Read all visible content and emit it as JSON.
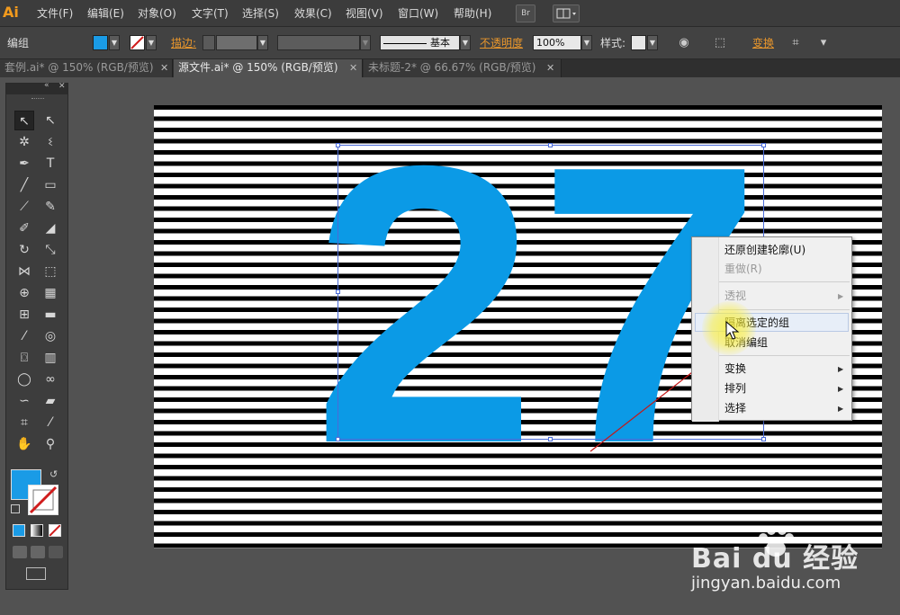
{
  "app": {
    "logo": "Ai",
    "menus": [
      "文件(F)",
      "编辑(E)",
      "对象(O)",
      "文字(T)",
      "选择(S)",
      "效果(C)",
      "视图(V)",
      "窗口(W)",
      "帮助(H)"
    ],
    "bridge_button": "Br"
  },
  "control_bar": {
    "selection_label": "编组",
    "fill_color": "#1a9be6",
    "stroke_label": "描边:",
    "stroke_style": "基本",
    "opacity_label": "不透明度",
    "opacity_value": "100%",
    "style_label": "样式:",
    "transform_label": "变换"
  },
  "tabs": [
    {
      "label": "套例.ai* @ 150% (RGB/预览)",
      "active": false
    },
    {
      "label": "源文件.ai* @ 150% (RGB/预览)",
      "active": true
    },
    {
      "label": "未标题-2* @ 66.67% (RGB/预览)",
      "active": false
    }
  ],
  "canvas": {
    "artwork_text": "27",
    "artwork_color": "#0b9ae6",
    "stripe_color": "#000000"
  },
  "context_menu": {
    "items": [
      {
        "label": "还原创建轮廓(U)",
        "disabled": false,
        "submenu": false
      },
      {
        "label": "重做(R)",
        "disabled": true,
        "submenu": false
      },
      {
        "label": "透视",
        "disabled": true,
        "submenu": true
      },
      {
        "label": "隔离选定的组",
        "disabled": false,
        "submenu": false,
        "highlighted": true
      },
      {
        "label": "取消编组",
        "disabled": false,
        "submenu": false
      },
      {
        "label": "变换",
        "disabled": false,
        "submenu": true
      },
      {
        "label": "排列",
        "disabled": false,
        "submenu": true
      },
      {
        "label": "选择",
        "disabled": false,
        "submenu": true
      }
    ]
  },
  "watermark": {
    "logo": "Bai du 经验",
    "url": "jingyan.baidu.com"
  }
}
